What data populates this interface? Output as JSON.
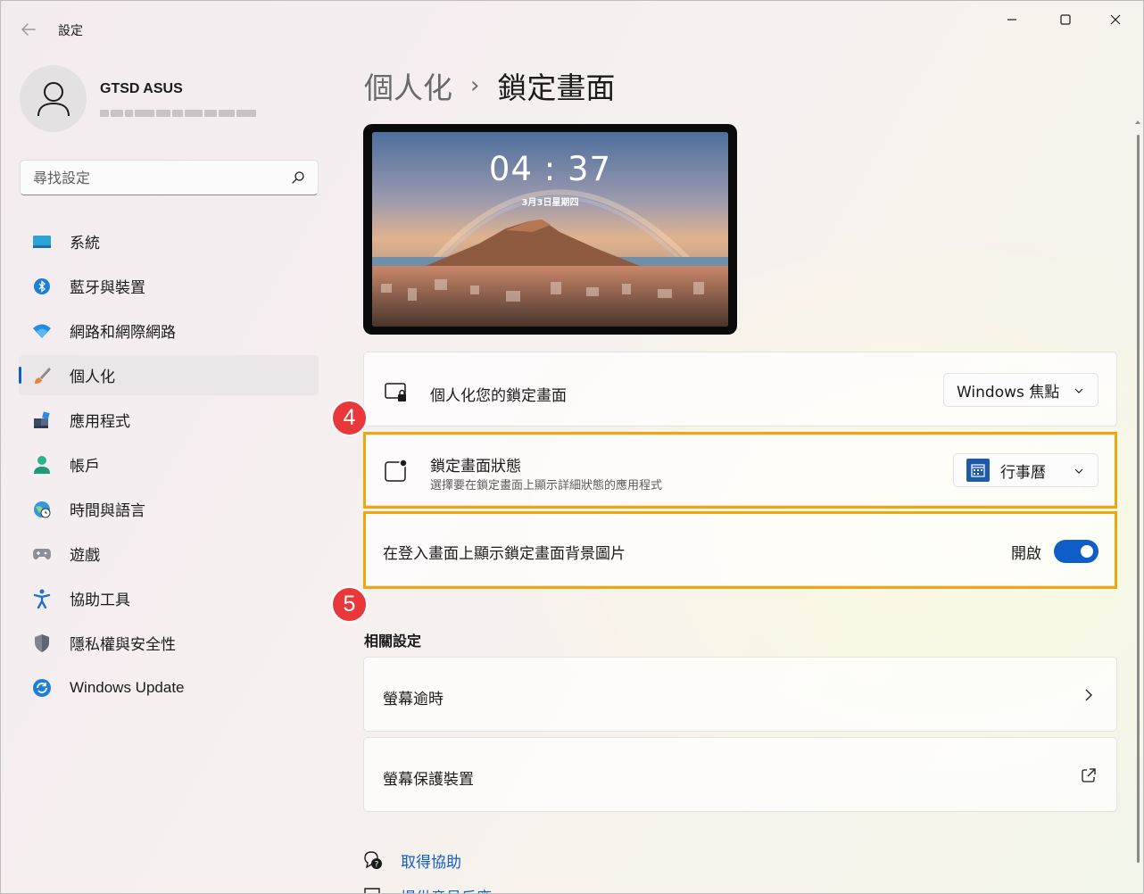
{
  "window": {
    "app_title": "設定"
  },
  "profile": {
    "name": "GTSD ASUS"
  },
  "search": {
    "placeholder": "尋找設定"
  },
  "sidebar": {
    "items": [
      {
        "label": "系統",
        "icon": "system-icon",
        "active": false
      },
      {
        "label": "藍牙與裝置",
        "icon": "bluetooth-icon",
        "active": false
      },
      {
        "label": "網路和網際網路",
        "icon": "wifi-icon",
        "active": false
      },
      {
        "label": "個人化",
        "icon": "brush-icon",
        "active": true
      },
      {
        "label": "應用程式",
        "icon": "apps-icon",
        "active": false
      },
      {
        "label": "帳戶",
        "icon": "account-icon",
        "active": false
      },
      {
        "label": "時間與語言",
        "icon": "globe-clock-icon",
        "active": false
      },
      {
        "label": "遊戲",
        "icon": "gamepad-icon",
        "active": false
      },
      {
        "label": "協助工具",
        "icon": "accessibility-icon",
        "active": false
      },
      {
        "label": "隱私權與安全性",
        "icon": "shield-icon",
        "active": false
      },
      {
        "label": "Windows Update",
        "icon": "windows-update-icon",
        "active": false
      }
    ]
  },
  "breadcrumb": {
    "parent": "個人化",
    "separator": "›",
    "current": "鎖定畫面"
  },
  "preview": {
    "time": "04 : 37",
    "date": "3月3日星期四"
  },
  "settings": {
    "personalize_lock": {
      "title": "個人化您的鎖定畫面",
      "dropdown_value": "Windows 焦點"
    },
    "lock_status": {
      "title": "鎖定畫面狀態",
      "subtitle": "選擇要在鎖定畫面上顯示詳細狀態的應用程式",
      "dropdown_value": "行事曆"
    },
    "signin_background": {
      "title": "在登入畫面上顯示鎖定畫面背景圖片",
      "toggle_label": "開啟",
      "toggle_on": true
    }
  },
  "badges": {
    "step4": "4",
    "step5": "5"
  },
  "related": {
    "title": "相關設定",
    "items": [
      {
        "label": "螢幕逾時",
        "icon": "chevron-right-icon"
      },
      {
        "label": "螢幕保護裝置",
        "icon": "external-link-icon"
      }
    ]
  },
  "links": {
    "help": "取得協助",
    "feedback": "提供意見反應"
  },
  "colors": {
    "accent": "#0f5ec7",
    "highlight": "#f1a60b",
    "badge": "#e8383b"
  }
}
